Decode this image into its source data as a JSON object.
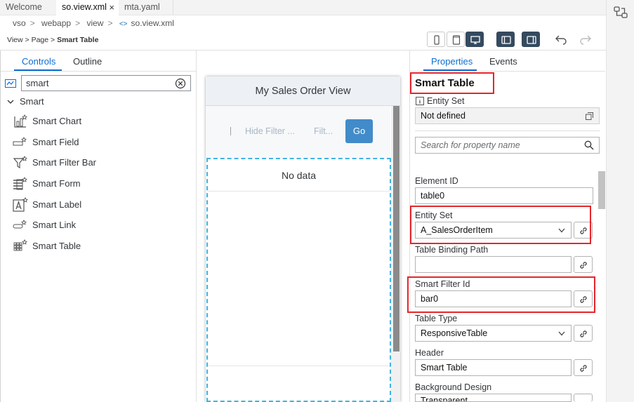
{
  "tabs": [
    {
      "label": "Welcome"
    },
    {
      "label": "so.view.xml",
      "close": "×"
    },
    {
      "label": "mta.yaml"
    }
  ],
  "breadcrumb": [
    "vso",
    "webapp",
    "view",
    "so.view.xml"
  ],
  "breadcrumb_code_glyph": "<>",
  "breadcrumb_sep": ">",
  "view_path": [
    "View",
    "Page",
    "Smart Table"
  ],
  "view_path_sep": ">",
  "left_panel": {
    "tabs": [
      "Controls",
      "Outline"
    ],
    "search_value": "smart",
    "group": "Smart",
    "items": [
      {
        "label": "Smart Chart",
        "icon": "smart-chart-icon"
      },
      {
        "label": "Smart Field",
        "icon": "smart-field-icon"
      },
      {
        "label": "Smart Filter Bar",
        "icon": "smart-filter-bar-icon"
      },
      {
        "label": "Smart Form",
        "icon": "smart-form-icon"
      },
      {
        "label": "Smart Label",
        "icon": "smart-label-icon"
      },
      {
        "label": "Smart Link",
        "icon": "smart-link-icon"
      },
      {
        "label": "Smart Table",
        "icon": "smart-table-icon"
      }
    ]
  },
  "canvas": {
    "title": "My Sales Order View",
    "filter_links": [
      "Hide Filter ...",
      "Filt..."
    ],
    "go": "Go",
    "no_data": "No data"
  },
  "right_panel": {
    "tabs": [
      "Properties",
      "Events"
    ],
    "title": "Smart Table",
    "entity_set_info_label": "Entity Set",
    "entity_set_info_value": "Not defined",
    "search_placeholder": "Search for property name",
    "props": {
      "element_id": {
        "label": "Element ID",
        "value": "table0"
      },
      "entity_set": {
        "label": "Entity Set",
        "value": "A_SalesOrderItem"
      },
      "binding_path": {
        "label": "Table Binding Path",
        "value": ""
      },
      "smart_filter_id": {
        "label": "Smart Filter Id",
        "value": "bar0"
      },
      "table_type": {
        "label": "Table Type",
        "value": "ResponsiveTable"
      },
      "header": {
        "label": "Header",
        "value": "Smart Table"
      },
      "background_design": {
        "label": "Background Design",
        "value": "Transparent"
      }
    }
  },
  "colors": {
    "accent": "#0a6ed1",
    "highlight": "#e5262b",
    "go_button": "#428bca",
    "dark_button": "#354a5f"
  }
}
